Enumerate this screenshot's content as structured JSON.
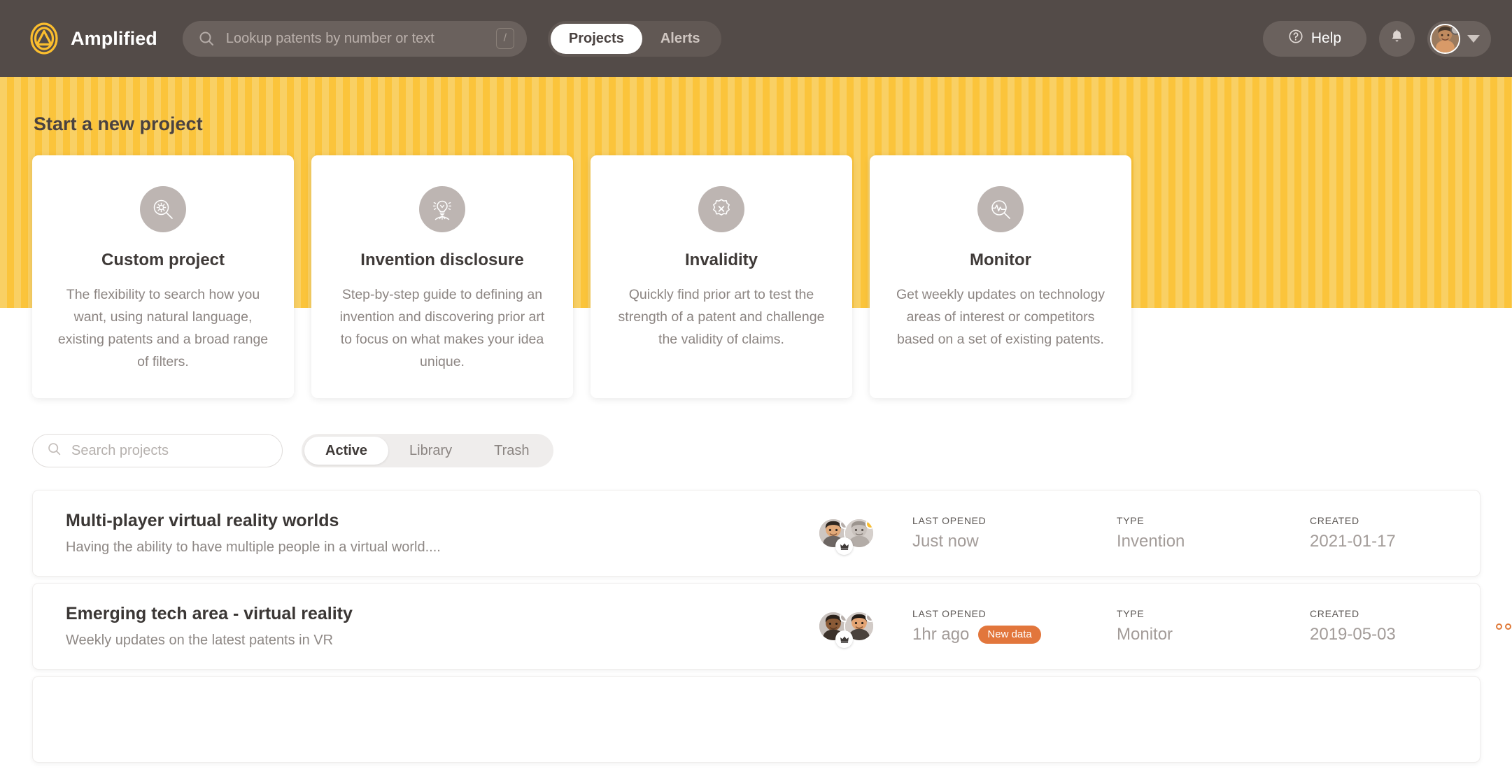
{
  "header": {
    "brand_name": "Amplified",
    "logo_icon": "amplified-triangle-logo",
    "search": {
      "placeholder": "Lookup patents by number or text",
      "value": "",
      "icon": "search-icon",
      "shortcut_key": "/"
    },
    "nav_tabs": [
      {
        "label": "Projects",
        "active": true
      },
      {
        "label": "Alerts",
        "active": false
      }
    ],
    "help_label": "Help",
    "help_icon": "question-circle-icon",
    "bell_icon": "bell-icon",
    "avatar_icon": "user-avatar",
    "caret_icon": "chevron-down-icon",
    "colors": {
      "bar": "#534B48",
      "field": "#6A615D",
      "accent": "#FBC43B"
    }
  },
  "banner": {
    "title": "Start a new project",
    "stripe_light": "#F9D064",
    "stripe_dark": "#FBC43B"
  },
  "starters": [
    {
      "icon": "magnifier-gear-icon",
      "title": "Custom project",
      "description": "The flexibility to search how you want, using natural language, existing patents and a broad range of filters."
    },
    {
      "icon": "lightbulb-idea-icon",
      "title": "Invention disclosure",
      "description": "Step-by-step guide to defining an invention and discovering prior art to focus on what makes your idea unique."
    },
    {
      "icon": "seal-x-icon",
      "title": "Invalidity",
      "description": "Quickly find prior art to test the strength of a patent and challenge the validity of claims."
    },
    {
      "icon": "magnifier-pulse-icon",
      "title": "Monitor",
      "description": "Get weekly updates on technology areas of interest or competitors based on a set of existing patents."
    }
  ],
  "filters": {
    "search_placeholder": "Search projects",
    "search_value": "",
    "search_icon": "search-icon",
    "tabs": [
      {
        "label": "Active",
        "active": true
      },
      {
        "label": "Library",
        "active": false
      },
      {
        "label": "Trash",
        "active": false
      }
    ]
  },
  "columns": {
    "last_opened": "LAST OPENED",
    "type": "TYPE",
    "created": "CREATED"
  },
  "projects": [
    {
      "title": "Multi-player virtual reality worlds",
      "description": "Having the ability to have multiple people in a virtual world....",
      "last_opened": "Just now",
      "badge": "",
      "type": "Invention",
      "created": "2021-01-17",
      "members": 2,
      "menu_icon": "more-options-icon",
      "menu_visible": false
    },
    {
      "title": "Emerging tech area - virtual reality",
      "description": "Weekly updates on the latest patents in VR",
      "last_opened": "1hr ago",
      "badge": "New data",
      "type": "Monitor",
      "created": "2019-05-03",
      "members": 2,
      "menu_icon": "more-options-icon",
      "menu_visible": true
    },
    {
      "title": "",
      "description": "",
      "last_opened": "",
      "badge": "",
      "type": "",
      "created": "",
      "members": 0,
      "menu_icon": "more-options-icon",
      "menu_visible": false
    }
  ],
  "badge_color": "#E2763C"
}
